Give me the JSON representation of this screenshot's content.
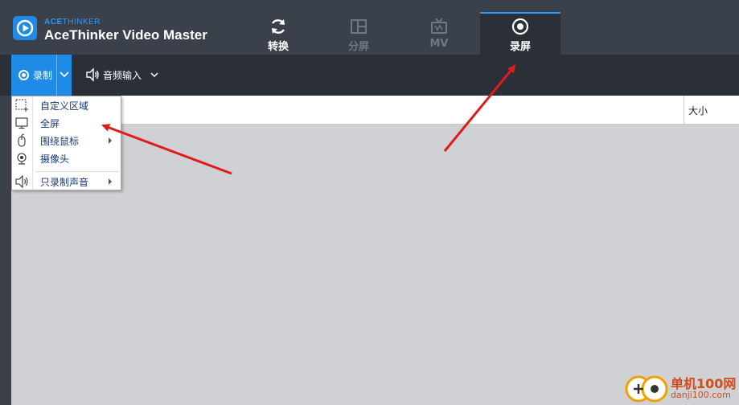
{
  "app": {
    "brand_small_bold": "ACE",
    "brand_small_thin": "THINKER",
    "title": "AceThinker Video Master"
  },
  "tabs": [
    {
      "label": "转换",
      "icon": "refresh-icon",
      "active": false
    },
    {
      "label": "分屏",
      "icon": "split-screen-icon",
      "active": false
    },
    {
      "label": "MV",
      "icon": "tv-icon",
      "active": false
    },
    {
      "label": "录屏",
      "icon": "record-icon",
      "active": true
    }
  ],
  "toolbar": {
    "record_label": "录制",
    "audio_label": "音频输入"
  },
  "list": {
    "columns": [
      "大小"
    ]
  },
  "menu": {
    "items": [
      {
        "label": "自定义区域",
        "icon": "custom-region-icon",
        "submenu": false
      },
      {
        "label": "全屏",
        "icon": "monitor-icon",
        "submenu": false
      },
      {
        "label": "围绕鼠标",
        "icon": "mouse-icon",
        "submenu": true
      },
      {
        "label": "摄像头",
        "icon": "webcam-icon",
        "submenu": false
      },
      {
        "label": "只录制声音",
        "icon": "speaker-icon",
        "submenu": true
      }
    ]
  },
  "watermark": {
    "cn": "单机100网",
    "en": "danji100.com"
  },
  "colors": {
    "accent": "#1e8be6",
    "header_bg": "#3a414b",
    "toolbar_bg": "#2b3038",
    "content_bg": "#d0d1d5",
    "annotation_arrow": "#e01b1b"
  }
}
